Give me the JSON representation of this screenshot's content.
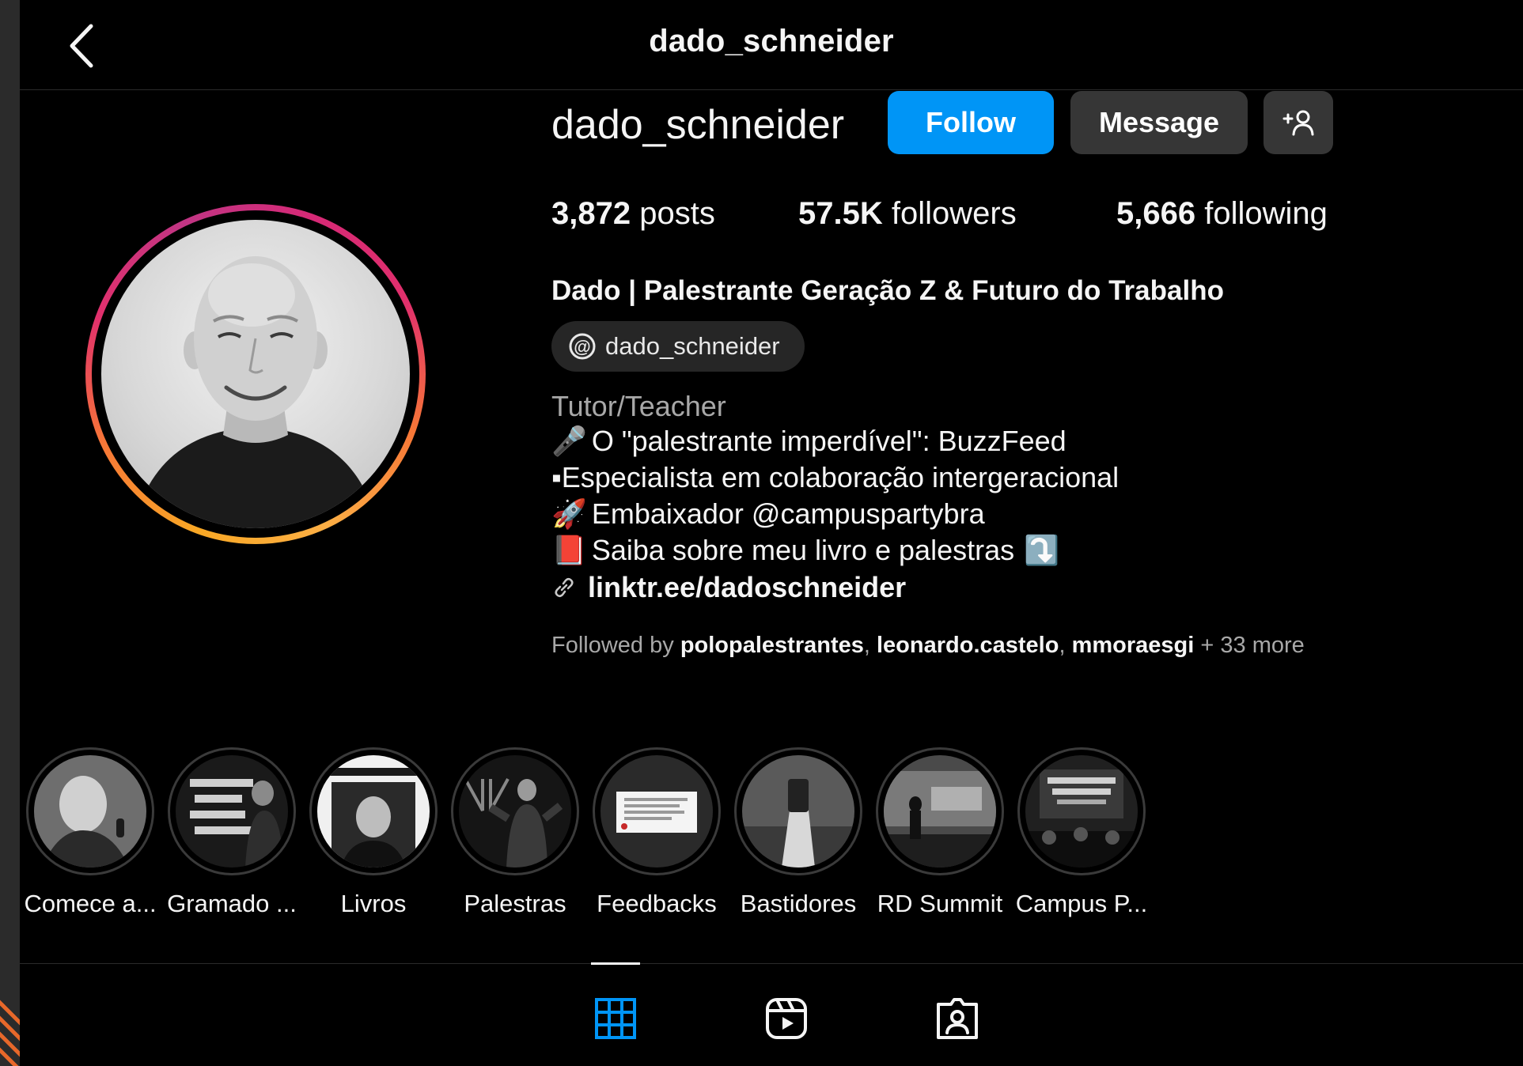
{
  "header": {
    "title": "dado_schneider",
    "back_icon": "chevron-left-icon"
  },
  "profile": {
    "username": "dado_schneider",
    "follow_label": "Follow",
    "message_label": "Message",
    "suggest_icon": "add-person-icon",
    "stats": {
      "posts_count": "3,872",
      "posts_label": "posts",
      "followers_count": "57.5K",
      "followers_label": "followers",
      "following_count": "5,666",
      "following_label": "following"
    },
    "full_name": "Dado | Palestrante Geração Z & Futuro do Trabalho",
    "threads_handle": "dado_schneider",
    "category": "Tutor/Teacher",
    "bio": [
      {
        "emoji": "🎤",
        "text": "O \"palestrante imperdível\": BuzzFeed"
      },
      {
        "emoji": "",
        "text": "▪Especialista em colaboração intergeracional"
      },
      {
        "emoji": "🚀",
        "text": "Embaixador @campuspartybra"
      },
      {
        "emoji": "📕",
        "text": "Saiba sobre meu livro e palestras",
        "suffix_emoji": "⤵️"
      }
    ],
    "link": "linktr.ee/dadoschneider",
    "followed_by": {
      "prefix": "Followed by",
      "names": [
        "polopalestrantes",
        "leonardo.castelo",
        "mmoraesgi"
      ],
      "more": "+ 33 more"
    }
  },
  "highlights": [
    {
      "label": "Comece a..."
    },
    {
      "label": "Gramado ..."
    },
    {
      "label": "Livros"
    },
    {
      "label": "Palestras"
    },
    {
      "label": "Feedbacks"
    },
    {
      "label": "Bastidores"
    },
    {
      "label": "RD Summit"
    },
    {
      "label": "Campus P..."
    }
  ],
  "tabs": [
    {
      "icon": "grid-icon",
      "active": true,
      "color": "#0095f6"
    },
    {
      "icon": "reels-icon",
      "active": false
    },
    {
      "icon": "tagged-icon",
      "active": false
    }
  ],
  "colors": {
    "accent": "#0095f6",
    "button_secondary": "#363636",
    "background": "#000000",
    "muted_text": "#a8a8a8"
  }
}
